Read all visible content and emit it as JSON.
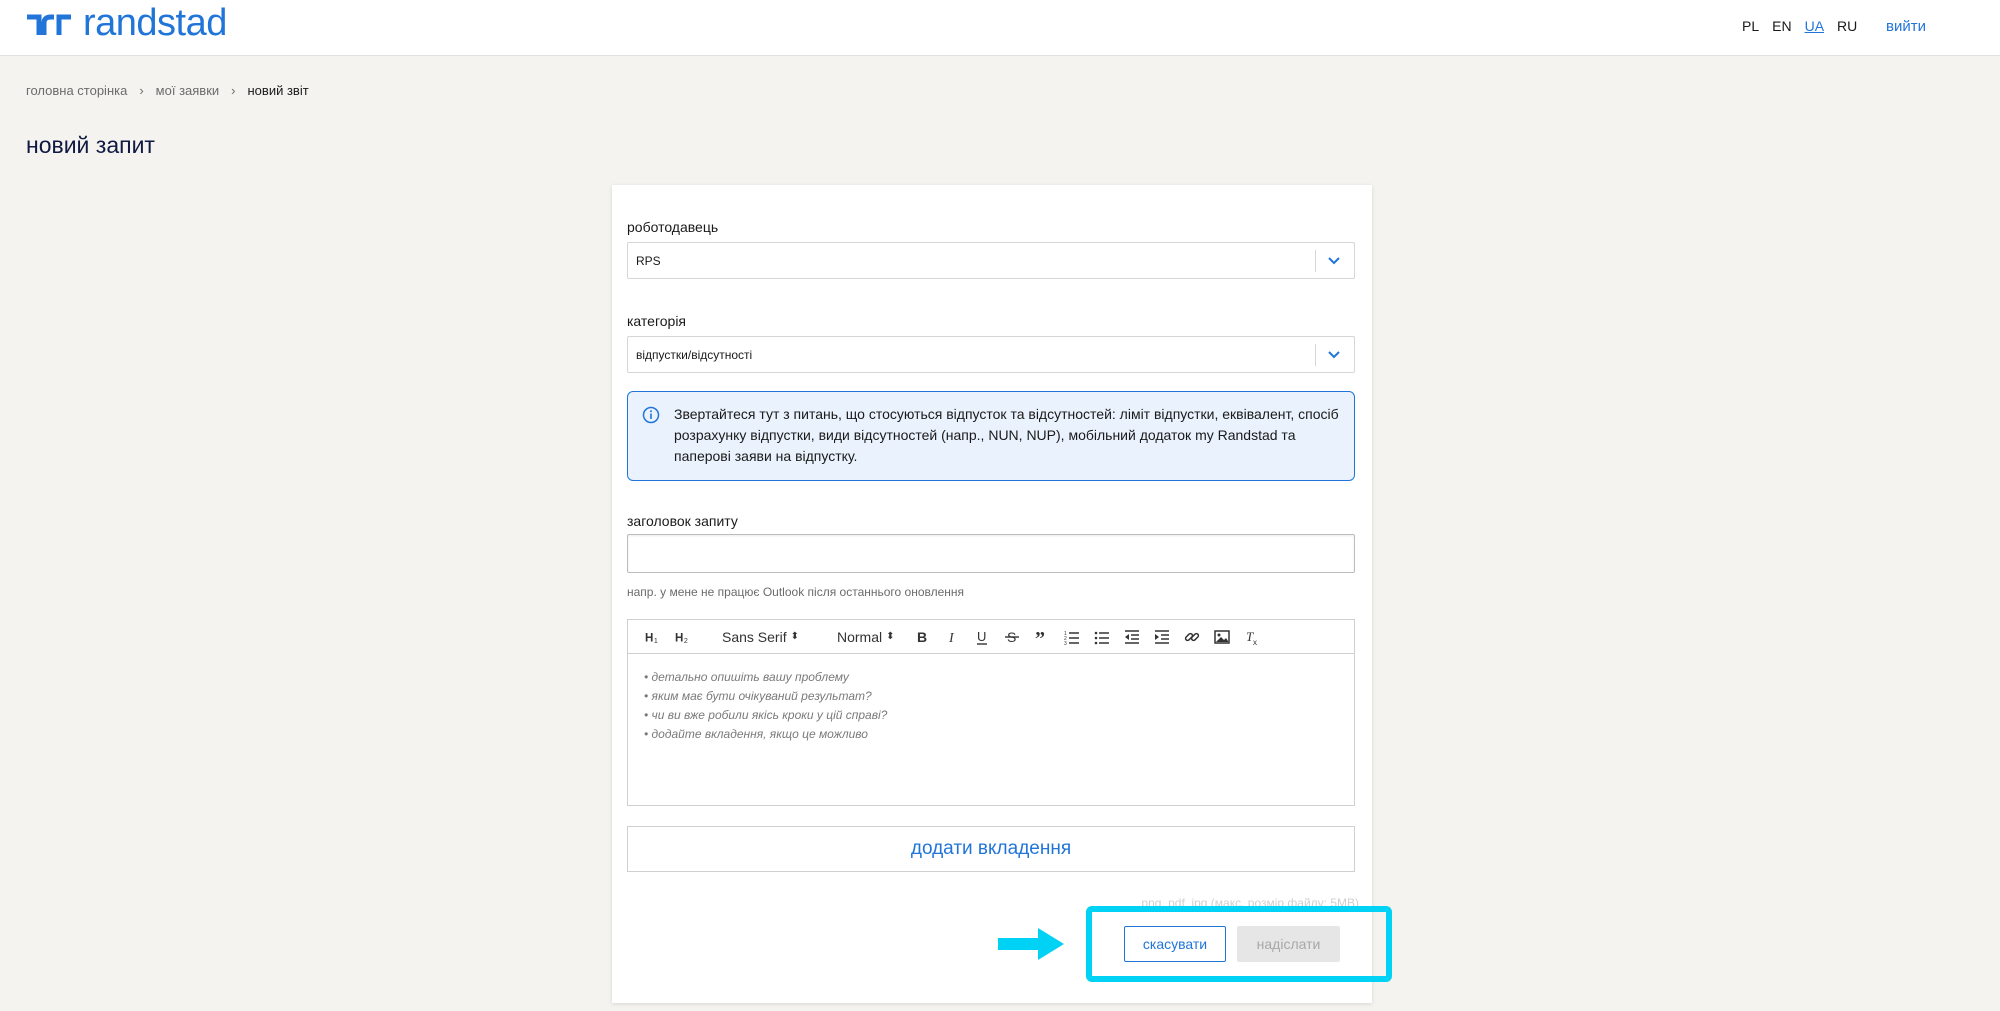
{
  "header": {
    "logo_text": "randstad",
    "languages": [
      "PL",
      "EN",
      "UA",
      "RU"
    ],
    "active_language": "UA",
    "logout_label": "вийти"
  },
  "breadcrumb": {
    "items": [
      "головна сторінка",
      "мої заявки",
      "новий звіт"
    ],
    "separator": "›"
  },
  "page_title": "новий запит",
  "form": {
    "employer": {
      "label": "роботодавець",
      "value": "RPS"
    },
    "category": {
      "label": "категорія",
      "value": "відпустки/відсутності"
    },
    "info_text": "Звертайтеся тут з питань, що стосуються відпусток та відсутностей: ліміт відпустки, еквівалент, спосіб розрахунку відпустки, види відсутностей (напр., NUN, NUP), мобільний додаток my Randstad та паперові заяви на відпустку.",
    "title_field": {
      "label": "заголовок запиту",
      "value": "",
      "hint": "напр. у мене не працює Outlook після останнього оновлення"
    },
    "editor": {
      "font_picker": "Sans Serif",
      "size_picker": "Normal",
      "placeholder_lines": [
        "• детально опишіть вашу проблему",
        "• яким має бути очікуваний результат?",
        "• чи ви вже робили якісь кроки у цій справі?",
        "• додайте вкладення, якщо це можливо"
      ]
    },
    "attach_label": "додати вкладення",
    "attach_hint": "png, pdf, jpg (макс. розмір файлу: 5MB)",
    "cancel_label": "скасувати",
    "send_label": "надіслати"
  },
  "colors": {
    "brand_blue": "#2175d9",
    "highlight_cyan": "#00d2f5",
    "page_bg": "#f5f3ef"
  }
}
